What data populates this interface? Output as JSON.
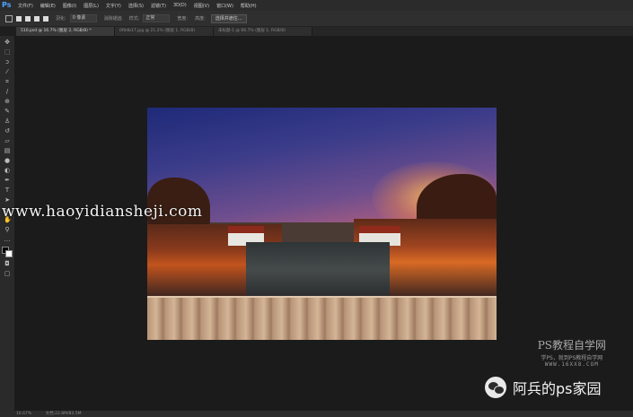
{
  "app": {
    "logo": "Ps"
  },
  "menu": [
    "文件(F)",
    "编辑(E)",
    "图像(I)",
    "图层(L)",
    "文字(Y)",
    "选择(S)",
    "滤镜(T)",
    "3D(D)",
    "视图(V)",
    "窗口(W)",
    "帮助(H)"
  ],
  "options": {
    "feather_label": "羽化:",
    "feather_value": "0 像素",
    "antialias_label": "消除锯齿",
    "style_label": "样式:",
    "style_value": "正常",
    "width_label": "宽度:",
    "height_label": "高度:",
    "select_mask_button": "选择并遮住..."
  },
  "tabs": [
    {
      "label": "510.psd @ 16.7% (图层 2, RGB/8) *",
      "active": true
    },
    {
      "label": "0f0db17.jpg @ 21.2% (图层 1, RGB/8)",
      "active": false
    },
    {
      "label": "未标题-1 @ 66.7% (图层 1, RGB/8)",
      "active": false
    }
  ],
  "tools": [
    "move-icon",
    "marquee-icon",
    "lasso-icon",
    "magic-wand-icon",
    "crop-icon",
    "eyedropper-icon",
    "healing-icon",
    "brush-icon",
    "stamp-icon",
    "history-brush-icon",
    "eraser-icon",
    "gradient-icon",
    "blur-icon",
    "dodge-icon",
    "pen-icon",
    "type-icon",
    "path-select-icon",
    "shape-icon",
    "hand-icon",
    "zoom-icon",
    "more-icon"
  ],
  "colors": {
    "foreground": "#000000",
    "background": "#ffffff",
    "accent": "#4da3ff"
  },
  "watermarks": {
    "site": "www.haoyidiansheji.com",
    "ps_title": "PS教程自学网",
    "ps_sub": "学PS，就到PS教程自学网",
    "ps_url": "WWW.16XX8.COM",
    "wechat": "阿兵的ps家园"
  },
  "status": {
    "zoom": "16.67%",
    "doc": "文档:22.8M/83.5M"
  }
}
